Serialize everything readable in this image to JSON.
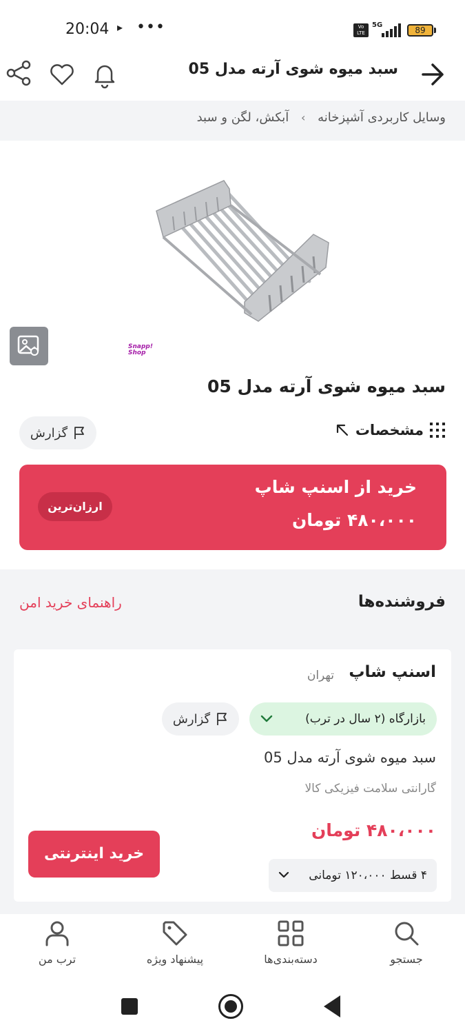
{
  "status_bar": {
    "time": "20:04",
    "play_icon": "▸",
    "dots": "•••",
    "volte": "Vo LTE",
    "network": "5G",
    "battery": "89"
  },
  "header": {
    "title": "سبد میوه شوی آرته مدل 05",
    "icons": [
      "back-arrow-icon",
      "bell-icon",
      "heart-icon",
      "share-icon"
    ]
  },
  "breadcrumb": {
    "items": [
      "وسایل کاربردی آشپزخانه",
      "آبکش، لگن و سبد"
    ],
    "separator": "›"
  },
  "product": {
    "title": "سبد میوه شوی آرته مدل 05",
    "image_icon": "dish-rack-image",
    "store_logo": "Snapp! Shop",
    "specs_label": "مشخصات",
    "report_label": "گزارش"
  },
  "buy_box": {
    "title": "خرید از اسنپ شاپ",
    "price": "۴۸۰،۰۰۰ تومان",
    "badge": "ارزان‌ترین",
    "color": "#e43f59"
  },
  "sellers": {
    "heading": "فروشنده‌ها",
    "safe_guide": "راهنمای خرید امن",
    "items": [
      {
        "name": "اسنپ شاپ",
        "city": "تهران",
        "bazar_label": "بازارگاه (۲ سال در ترب)",
        "report_label": "گزارش",
        "product_name": "سبد میوه شوی آرته مدل 05",
        "warranty": "گارانتی سلامت فیزیکی کالا",
        "price": "۴۸۰،۰۰۰ تومان",
        "installment": "۴ قسط ۱۲۰،۰۰۰ تومانی",
        "buy_button": "خرید اینترنتی"
      }
    ]
  },
  "bottom_nav": {
    "items": [
      {
        "label": "جستجو",
        "icon": "search-icon"
      },
      {
        "label": "دسته‌بندی‌ها",
        "icon": "grid-icon"
      },
      {
        "label": "پیشنهاد ویژه",
        "icon": "tag-icon"
      },
      {
        "label": "ترب من",
        "icon": "user-icon"
      }
    ]
  }
}
